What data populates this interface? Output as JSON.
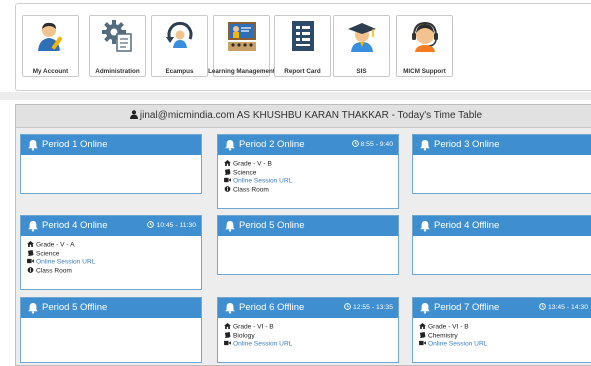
{
  "shortcuts": [
    {
      "label": "My Account",
      "icon": "user-pen-icon"
    },
    {
      "label": "Administration",
      "icon": "gear-doc-icon"
    },
    {
      "label": "Ecampus",
      "icon": "ecampus-cycle-icon"
    },
    {
      "label": "Learning Management",
      "icon": "presentation-icon"
    },
    {
      "label": "Report Card",
      "icon": "report-card-icon"
    },
    {
      "label": "SIS",
      "icon": "graduate-icon"
    },
    {
      "label": "MICM Support",
      "icon": "headset-icon"
    }
  ],
  "timetable": {
    "header": "jinal@micmindia.com AS KHUSHBU KARAN THAKKAR - Today's Time Table"
  },
  "periods": [
    {
      "title": "Period 1 Online",
      "time": "",
      "grade": "",
      "subject": "",
      "session": "",
      "room": ""
    },
    {
      "title": "Period 2 Online",
      "time": "8:55 - 9:40",
      "grade": "Grade - V - B",
      "subject": "Science",
      "session": "Online Session URL",
      "room": "Class Room"
    },
    {
      "title": "Period 3 Online",
      "time": "",
      "grade": "",
      "subject": "",
      "session": "",
      "room": ""
    },
    {
      "title": "Period 4 Online",
      "time": "10:45 - 11:30",
      "grade": "Grade - V - A",
      "subject": "Science",
      "session": "Online Session URL",
      "room": "Class Room"
    },
    {
      "title": "Period 5 Online",
      "time": "",
      "grade": "",
      "subject": "",
      "session": "",
      "room": ""
    },
    {
      "title": "Period 4 Offline",
      "time": "",
      "grade": "",
      "subject": "",
      "session": "",
      "room": ""
    },
    {
      "title": "Period 5 Offline",
      "time": "",
      "grade": "",
      "subject": "",
      "session": "",
      "room": ""
    },
    {
      "title": "Period 6 Offline",
      "time": "12:55 - 13:35",
      "grade": "Grade - VI - B",
      "subject": "Biology",
      "session": "Online Session URL",
      "room": ""
    },
    {
      "title": "Period 7 Offline",
      "time": "13:45 - 14:30",
      "grade": "Grade - VI - B",
      "subject": "Chemistry",
      "session": "Online Session URL",
      "room": ""
    }
  ],
  "colors": {
    "card_header": "#3e8ed0",
    "link": "#3f7fbf",
    "panel_bg": "#ededed"
  }
}
